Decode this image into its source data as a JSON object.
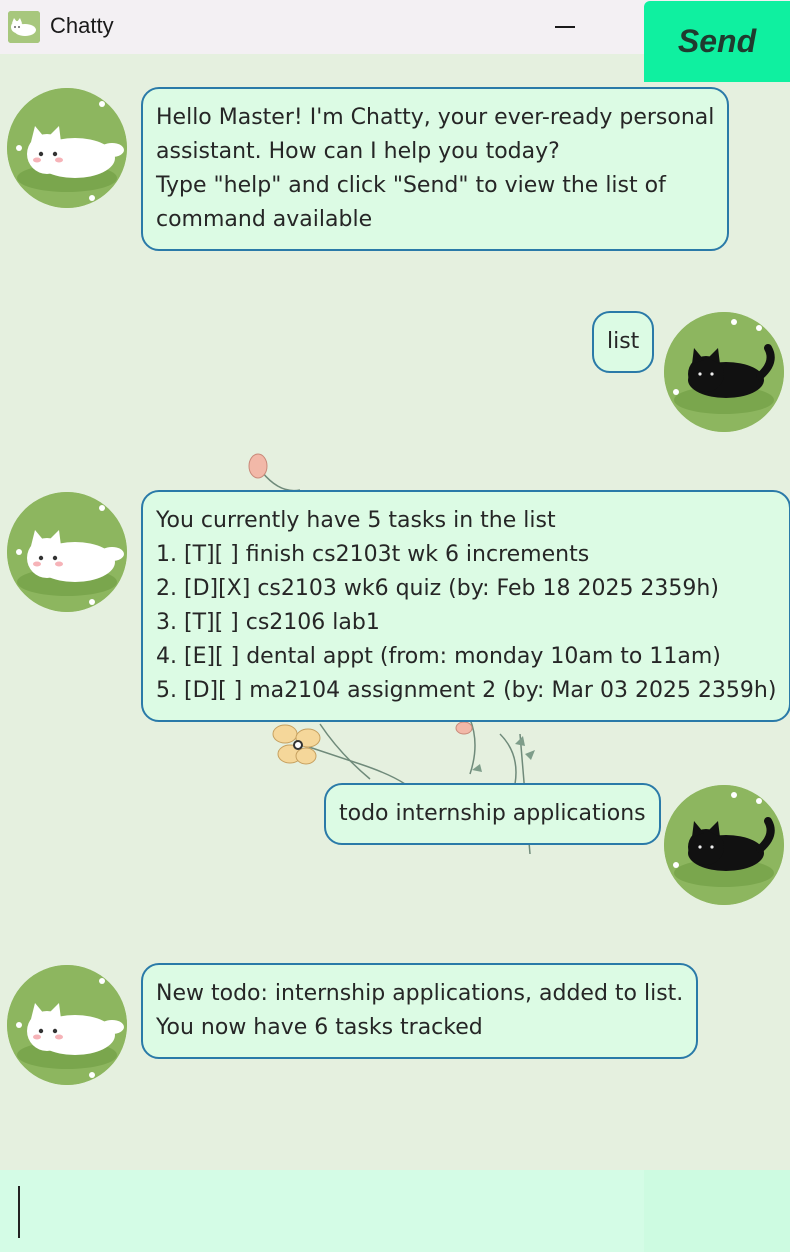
{
  "window": {
    "title": "Chatty",
    "icon": "cat-app-icon",
    "controls": [
      "minimize-icon",
      "maximize-icon",
      "close-icon"
    ]
  },
  "colors": {
    "chat_background": "#e5f0df",
    "bubble_fill": "#dcfbe4",
    "bubble_border": "#2a7aa8",
    "send_button": "#0ff0a0",
    "input_background": "#d4fce6"
  },
  "messages": [
    {
      "sender": "bot",
      "avatar": "white-cat-avatar",
      "lines": [
        "Hello Master! I'm Chatty, your ever-ready personal",
        "assistant. How can I help you today?",
        "Type \"help\" and click \"Send\" to view the list of",
        "command available"
      ]
    },
    {
      "sender": "user",
      "avatar": "black-cat-avatar",
      "lines": [
        "list"
      ]
    },
    {
      "sender": "bot",
      "avatar": "white-cat-avatar",
      "lines": [
        "You currently have 5 tasks in the list",
        "1. [T][ ] finish cs2103t wk 6 increments",
        "2. [D][X] cs2103 wk6 quiz (by: Feb 18 2025 2359h)",
        "3. [T][ ] cs2106 lab1",
        "4. [E][ ] dental appt (from: monday 10am to 11am)",
        "5. [D][ ] ma2104 assignment 2 (by: Mar 03 2025 2359h)"
      ]
    },
    {
      "sender": "user",
      "avatar": "black-cat-avatar",
      "lines": [
        "todo internship applications"
      ]
    },
    {
      "sender": "bot",
      "avatar": "white-cat-avatar",
      "lines": [
        "New todo: internship applications, added to list.",
        "You now have 6 tasks tracked"
      ]
    }
  ],
  "input": {
    "value": "",
    "placeholder": ""
  },
  "send_button": {
    "label": "Send"
  }
}
